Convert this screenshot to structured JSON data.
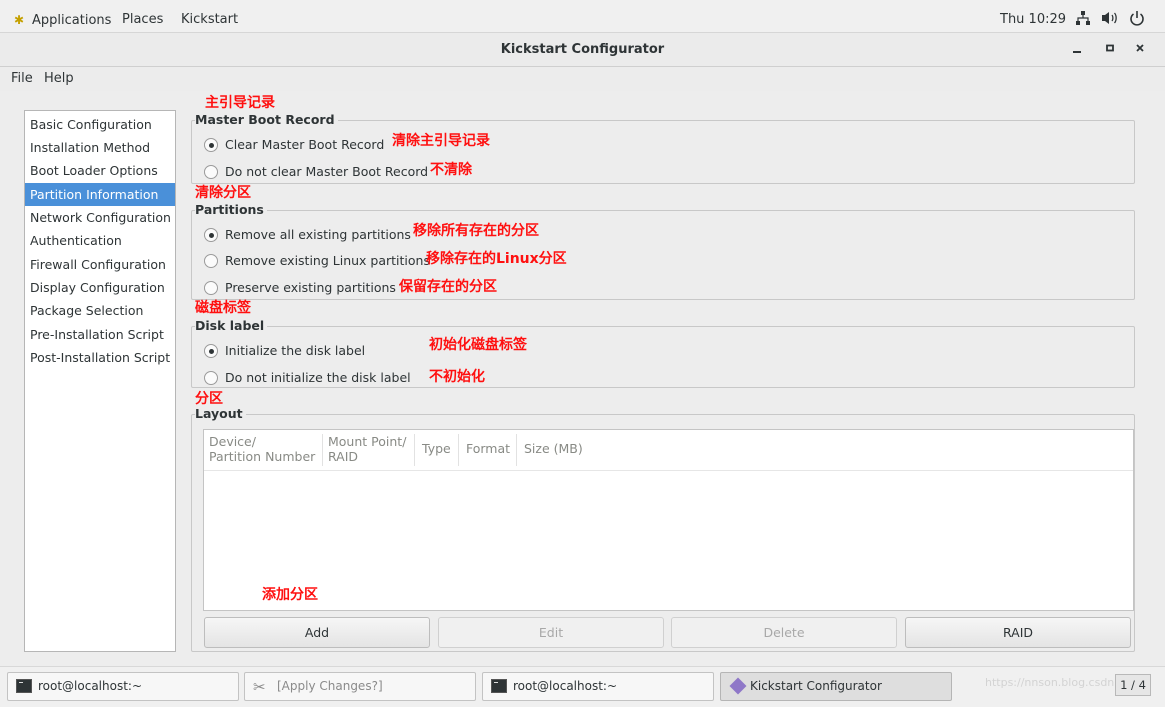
{
  "top_panel": {
    "applications": "Applications",
    "places": "Places",
    "app_name": "Kickstart",
    "clock": "Thu 10:29",
    "icons": [
      "network-icon",
      "volume-icon",
      "power-icon"
    ]
  },
  "window": {
    "title": "Kickstart Configurator",
    "controls": [
      "minimize-icon",
      "maximize-icon",
      "close-icon"
    ]
  },
  "menu": {
    "file": "File",
    "help": "Help"
  },
  "sidebar": {
    "items": [
      {
        "label": "Basic Configuration"
      },
      {
        "label": "Installation Method"
      },
      {
        "label": "Boot Loader Options"
      },
      {
        "label": "Partition Information",
        "selected": true
      },
      {
        "label": "Network Configuration"
      },
      {
        "label": "Authentication"
      },
      {
        "label": "Firewall Configuration"
      },
      {
        "label": "Display Configuration"
      },
      {
        "label": "Package Selection"
      },
      {
        "label": "Pre-Installation Script"
      },
      {
        "label": "Post-Installation Script"
      }
    ]
  },
  "mbr": {
    "label": "Master Boot Record",
    "options": [
      {
        "label": "Clear Master Boot Record",
        "checked": true
      },
      {
        "label": "Do not clear Master Boot Record",
        "checked": false
      }
    ]
  },
  "partitions": {
    "label": "Partitions",
    "options": [
      {
        "label": "Remove all existing partitions",
        "checked": true
      },
      {
        "label": "Remove existing Linux partitions",
        "checked": false
      },
      {
        "label": "Preserve existing partitions",
        "checked": false
      }
    ]
  },
  "disk_label": {
    "label": "Disk label",
    "options": [
      {
        "label": "Initialize the disk label",
        "checked": true
      },
      {
        "label": "Do not initialize the disk label",
        "checked": false
      }
    ]
  },
  "layout": {
    "label": "Layout",
    "columns": {
      "device_line1": "Device/",
      "device_line2": "Partition Number",
      "mount_line1": "Mount Point/",
      "mount_line2": "RAID",
      "type": "Type",
      "format": "Format",
      "size": "Size (MB)"
    },
    "rows": []
  },
  "buttons": {
    "add": "Add",
    "edit": "Edit",
    "delete": "Delete",
    "raid": "RAID"
  },
  "annotations": {
    "mbr_title": "主引导记录",
    "clear_mbr": "清除主引导记录",
    "no_clear": "不清除",
    "clear_partitions": "清除分区",
    "remove_all": "移除所有存在的分区",
    "remove_linux": "移除存在的Linux分区",
    "preserve": "保留存在的分区",
    "disk_label_title": "磁盘标签",
    "init_label": "初始化磁盘标签",
    "no_init": "不初始化",
    "partition": "分区",
    "add_partition": "添加分区"
  },
  "taskbar": {
    "tasks": [
      {
        "label": "root@localhost:~"
      },
      {
        "label": "[Apply Changes?]"
      },
      {
        "label": "root@localhost:~"
      },
      {
        "label": "Kickstart Configurator",
        "active": true
      }
    ],
    "watermark": "https://nnson.blog.csdn",
    "pager": "1 / 4"
  },
  "colors": {
    "selection": "#4a90d9",
    "annotation": "#ff1010"
  }
}
